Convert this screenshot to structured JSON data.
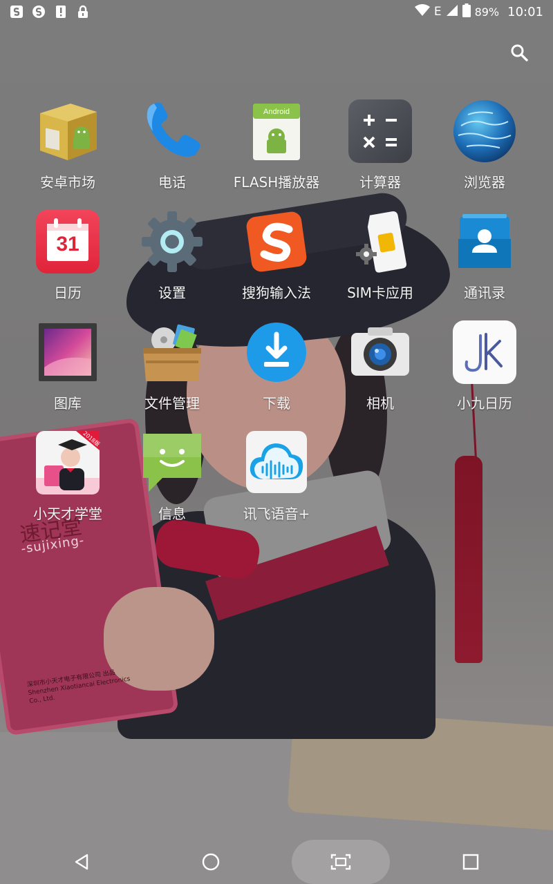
{
  "status_bar": {
    "notification_icons": [
      "sogou-icon",
      "sogou-s-icon",
      "alert-icon",
      "lock-icon"
    ],
    "network_type": "E",
    "battery_percent": "89%",
    "time": "10:01"
  },
  "apps": [
    {
      "label": "安卓市场",
      "icon": "android-market-icon"
    },
    {
      "label": "电话",
      "icon": "phone-icon"
    },
    {
      "label": "FLASH播放器",
      "icon": "flash-player-icon"
    },
    {
      "label": "计算器",
      "icon": "calculator-icon"
    },
    {
      "label": "浏览器",
      "icon": "browser-globe-icon"
    },
    {
      "label": "日历",
      "icon": "calendar-icon",
      "calendar_day": "31"
    },
    {
      "label": "设置",
      "icon": "settings-gear-icon"
    },
    {
      "label": "搜狗输入法",
      "icon": "sogou-input-icon"
    },
    {
      "label": "SIM卡应用",
      "icon": "sim-card-icon"
    },
    {
      "label": "通讯录",
      "icon": "contacts-icon"
    },
    {
      "label": "图库",
      "icon": "gallery-icon"
    },
    {
      "label": "文件管理",
      "icon": "file-manager-icon"
    },
    {
      "label": "下载",
      "icon": "download-icon"
    },
    {
      "label": "相机",
      "icon": "camera-icon"
    },
    {
      "label": "小九日历",
      "icon": "xiaojiu-calendar-icon"
    },
    {
      "label": "小天才学堂",
      "icon": "xiaotiancai-school-icon",
      "badge": "2018版"
    },
    {
      "label": "信息",
      "icon": "messages-icon"
    },
    {
      "label": "讯飞语音+",
      "icon": "iflytek-voice-icon"
    }
  ],
  "wallpaper_text": {
    "book_brand": "速记堂",
    "book_sub": "-sujixing-",
    "book_company": "深圳市小天才电子有限公司 出品",
    "book_company_en": "Shenzhen Xiaotiancai Electronics Co., Ltd."
  },
  "navbar": [
    "back-icon",
    "home-icon",
    "screenshot-icon",
    "recents-icon"
  ]
}
